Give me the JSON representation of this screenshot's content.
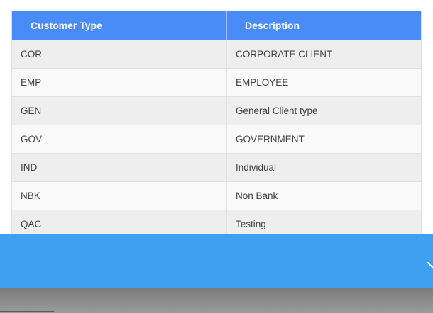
{
  "table": {
    "headers": [
      "Customer Type",
      "Description"
    ],
    "rows": [
      [
        "COR",
        "CORPORATE CLIENT"
      ],
      [
        "EMP",
        "EMPLOYEE"
      ],
      [
        "GEN",
        "General Client type"
      ],
      [
        "GOV",
        "GOVERNMENT"
      ],
      [
        "IND",
        "Individual"
      ],
      [
        "NBK",
        "Non Bank"
      ],
      [
        "QAC",
        "Testing"
      ]
    ]
  },
  "colors": {
    "header_bg": "#4a8cf7",
    "banner_bg": "#3fa0f2",
    "row_odd": "#eeeeee",
    "row_even": "#f9f9f9"
  },
  "banner": {
    "icon": "chevron-down-icon"
  }
}
